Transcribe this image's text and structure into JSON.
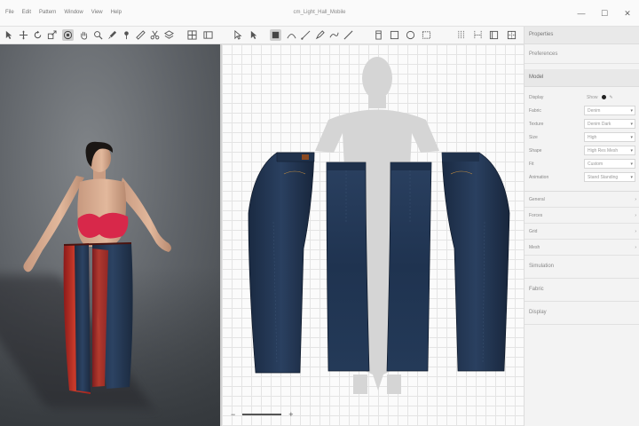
{
  "window": {
    "title": "cm_Light_Hall_Mobile",
    "menu": [
      "File",
      "Edit",
      "Pattern",
      "Window",
      "View",
      "Help"
    ],
    "controls": [
      "—",
      "☐",
      "✕"
    ]
  },
  "toolbar": {
    "icons": [
      "select-icon",
      "move-icon",
      "rotate-icon",
      "scale-icon",
      "camera-icon",
      "pan-icon",
      "zoom-icon",
      "brush-icon",
      "pin-icon",
      "measure-icon",
      "cut-icon",
      "layer-icon",
      "pointer-icon",
      "select-arrow-icon",
      "edit-point-icon",
      "curve-icon",
      "segment-icon",
      "pen-icon",
      "line-icon",
      "rectangle-icon",
      "square-icon",
      "ellipse-icon",
      "seam-icon",
      "fold-icon",
      "dart-icon",
      "notch-icon"
    ]
  },
  "panel": {
    "title": "Properties",
    "preferences": "Preferences",
    "section_model": "Model",
    "properties": [
      {
        "label": "Display",
        "value": "Show",
        "type": "controls"
      },
      {
        "label": "Fabric",
        "value": "Denim"
      },
      {
        "label": "Texture",
        "value": "Denim Dark"
      },
      {
        "label": "Size",
        "value": "High"
      },
      {
        "label": "Shape",
        "value": "High Res Mesh"
      },
      {
        "label": "Fit",
        "value": "Custom"
      },
      {
        "label": "Animation",
        "value": "Stand Standing"
      }
    ],
    "groups": [
      {
        "label": "General"
      },
      {
        "label": "Forces"
      },
      {
        "label": "Grid"
      },
      {
        "label": "Mesh"
      }
    ],
    "collapsed": [
      "Simulation",
      "Fabric",
      "Display"
    ]
  },
  "zoom": {
    "minus": "−",
    "plus": "+"
  },
  "colors": {
    "denim": "#1e2f48",
    "top": "#d8284a",
    "accent": "#d5d5d5"
  }
}
